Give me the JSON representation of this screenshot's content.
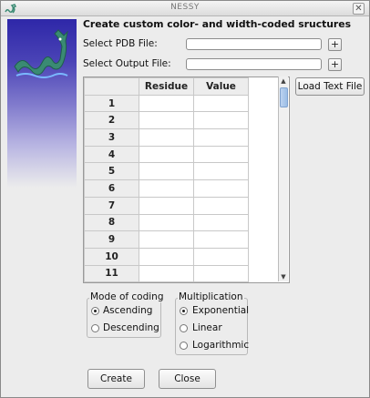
{
  "window": {
    "title": "NESSY",
    "close_glyph": "✕"
  },
  "heading": "Create custom color- and width-coded sructures",
  "pdb": {
    "label": "Select PDB File:",
    "value": "",
    "browse_label": "+"
  },
  "output": {
    "label": "Select Output File:",
    "value": "",
    "browse_label": "+"
  },
  "load_text_file_label": "Load Text File",
  "table": {
    "columns": [
      "",
      "Residue",
      "Value"
    ],
    "rows": [
      {
        "num": "1",
        "residue": "",
        "value": ""
      },
      {
        "num": "2",
        "residue": "",
        "value": ""
      },
      {
        "num": "3",
        "residue": "",
        "value": ""
      },
      {
        "num": "4",
        "residue": "",
        "value": ""
      },
      {
        "num": "5",
        "residue": "",
        "value": ""
      },
      {
        "num": "6",
        "residue": "",
        "value": ""
      },
      {
        "num": "7",
        "residue": "",
        "value": ""
      },
      {
        "num": "8",
        "residue": "",
        "value": ""
      },
      {
        "num": "9",
        "residue": "",
        "value": ""
      },
      {
        "num": "10",
        "residue": "",
        "value": ""
      },
      {
        "num": "11",
        "residue": "",
        "value": ""
      }
    ]
  },
  "mode_of_coding": {
    "title": "Mode of coding",
    "options": [
      {
        "label": "Ascending",
        "selected": true
      },
      {
        "label": "Descending",
        "selected": false
      }
    ]
  },
  "multiplication": {
    "title": "Multiplication",
    "options": [
      {
        "label": "Exponential",
        "selected": true
      },
      {
        "label": "Linear",
        "selected": false
      },
      {
        "label": "Logarithmic",
        "selected": false
      }
    ]
  },
  "buttons": {
    "create": "Create",
    "close": "Close"
  },
  "icons": {
    "app": "sea-serpent-icon",
    "scroll_up": "arrow-up-icon",
    "scroll_down": "arrow-down-icon"
  },
  "colors": {
    "banner_top": "#2e27a8",
    "serpent": "#3a8a73"
  }
}
